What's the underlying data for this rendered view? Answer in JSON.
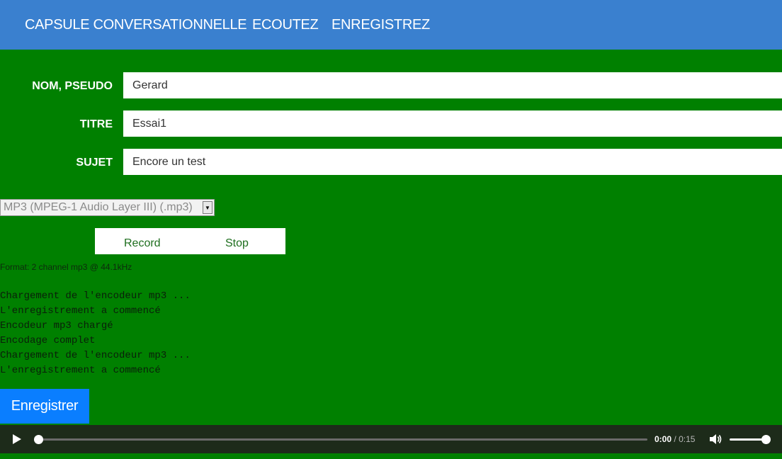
{
  "nav": {
    "items": [
      {
        "label": "CAPSULE CONVERSATIONNELLE"
      },
      {
        "label": "ECOUTEZ"
      },
      {
        "label": "ENREGISTREZ"
      }
    ]
  },
  "form": {
    "fields": [
      {
        "label": "NOM, PSEUDO",
        "value": "Gerard"
      },
      {
        "label": "TITRE",
        "value": "Essai1"
      },
      {
        "label": "SUJET",
        "value": "Encore un test"
      }
    ]
  },
  "recorder": {
    "format_selected": "MP3 (MPEG-1 Audio Layer III) (.mp3)",
    "record_label": "Record",
    "stop_label": "Stop",
    "format_info": "Format: 2 channel mp3 @ 44.1kHz",
    "log": [
      "Chargement de l'encodeur mp3 ...",
      "L'enregistrement a commencé",
      "Encodeur mp3 chargé",
      "Encodage complet",
      "Chargement de l'encodeur mp3 ...",
      "L'enregistrement a commencé"
    ]
  },
  "submit_label": "Enregistrer",
  "player": {
    "current_time": "0:00",
    "separator": "/",
    "total_time": "0:15",
    "progress": 0,
    "volume": 1,
    "icons": {
      "play": "play-icon",
      "volume": "volume-icon"
    }
  },
  "colors": {
    "page_background": "#008000",
    "navbar": "#3a80cf",
    "submit_button": "#0a7eff",
    "player_background": "#1d2b1a"
  }
}
